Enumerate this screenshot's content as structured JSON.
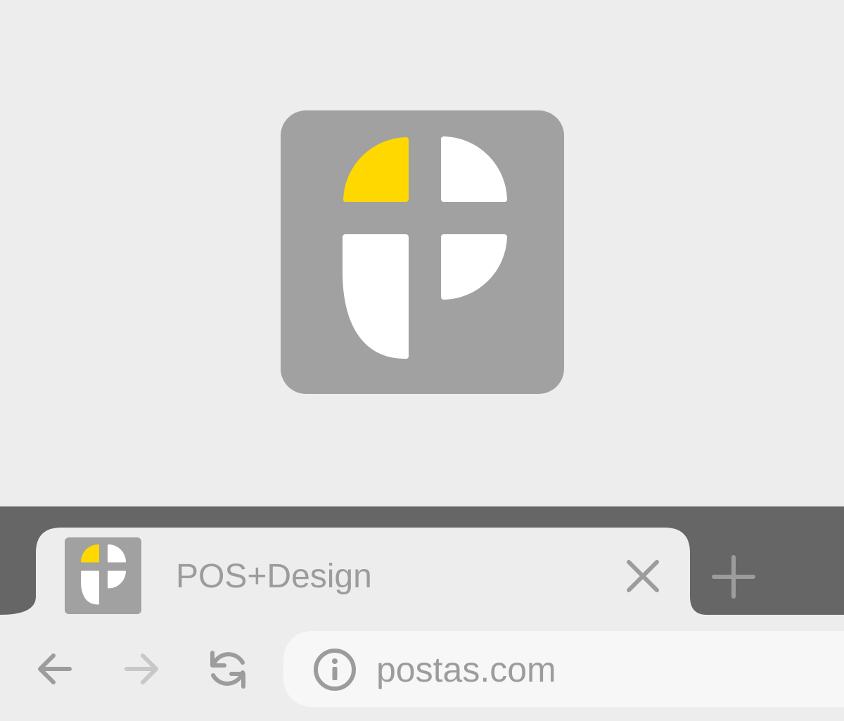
{
  "logo": {
    "name": "POS+Design logo",
    "colors": {
      "background": "#a1a1a1",
      "accent": "#ffd800",
      "shape": "#ffffff"
    }
  },
  "browser": {
    "tab": {
      "title": "POS+Design",
      "favicon": "posdesign-logo-icon",
      "close_icon": "close-icon"
    },
    "new_tab_icon": "plus-icon",
    "nav": {
      "back_icon": "arrow-left-icon",
      "forward_icon": "arrow-right-icon",
      "forward_enabled": false,
      "reload_icon": "reload-icon"
    },
    "omnibox": {
      "site_info_icon": "info-icon",
      "url": "postas.com"
    },
    "colors": {
      "tab_strip": "#666666",
      "active_tab": "#ededed",
      "omnibox": "#f7f7f7",
      "icon": "#9c9c9c",
      "icon_disabled": "#c8c8c8"
    }
  }
}
